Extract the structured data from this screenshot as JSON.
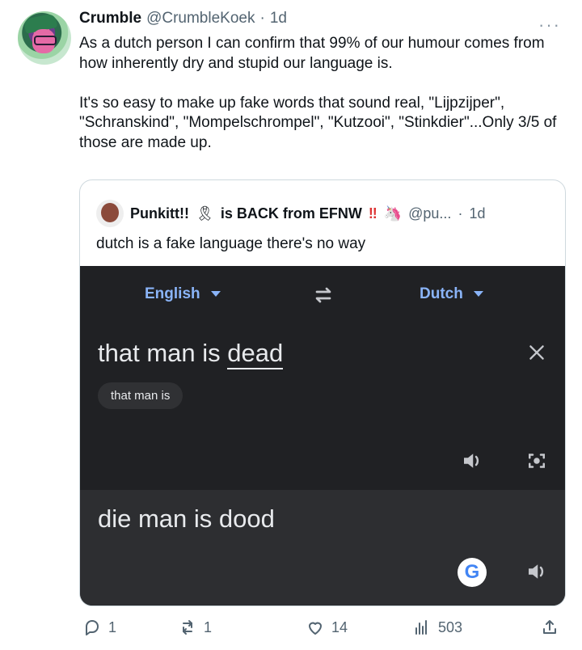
{
  "tweet": {
    "author_name": "Crumble",
    "handle": "@CrumbleKoek",
    "dot": "·",
    "time": "1d",
    "text": "As a dutch person I can confirm that 99% of our humour comes from how inherently dry and stupid our language is.\n\nIt's so easy to make up fake words that sound real, \"Lijpzijper\", \"Schranskind\", \"Mompelschrompel\", \"Kutzooi\", \"Stinkdier\"...Only 3/5 of those are made up.",
    "more_label": "···"
  },
  "quote": {
    "author_name": "Punkitt!!",
    "middle_text": "is BACK from EFNW",
    "emoji_bang": "‼",
    "handle": "@pu...",
    "dot": "·",
    "time": "1d",
    "text": "dutch is a fake language there's no way",
    "unicorn_icon": "🦄",
    "ribbon_icon": "🎗"
  },
  "translate": {
    "source_lang": "English",
    "target_lang": "Dutch",
    "source_text_prefix": "that man is ",
    "source_text_underlined": "dead",
    "suggestion": "that man is",
    "target_text": "die man is dood",
    "google_label": "G"
  },
  "actions": {
    "replies": "1",
    "retweets": "1",
    "likes": "14",
    "views": "503"
  },
  "colors": {
    "accent_blue": "#8ab4f8",
    "dark_bg": "#202124",
    "output_bg": "#2d2e31",
    "muted": "#536471"
  }
}
